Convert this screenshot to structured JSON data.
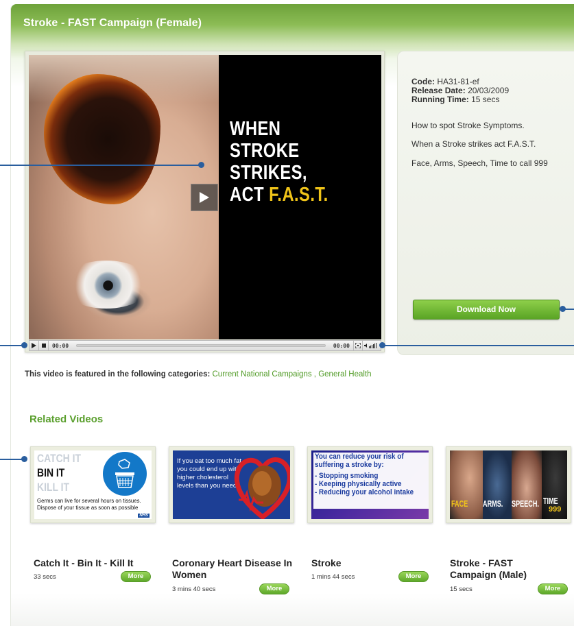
{
  "header": {
    "title": "Stroke - FAST Campaign (Female)"
  },
  "player": {
    "slogan": {
      "line1": "WHEN",
      "line2": "STROKE STRIKES,",
      "line3_prefix": "ACT ",
      "line3_highlight": "F.A.S.T."
    },
    "time_elapsed": "00:00",
    "time_total": "00:00"
  },
  "info": {
    "code_label": "Code:",
    "code_value": "HA31-81-ef",
    "release_label": "Release Date:",
    "release_value": "20/03/2009",
    "running_label": "Running Time:",
    "running_value": "15 secs",
    "desc1": "How to spot Stroke Symptoms.",
    "desc2": "When a Stroke strikes act F.A.S.T.",
    "desc3": "Face, Arms, Speech, Time to call 999",
    "download_label": "Download Now"
  },
  "categories": {
    "prefix": "This video is featured in the following categories:",
    "items": [
      "Current National Campaigns",
      "General Health"
    ],
    "separator": " , "
  },
  "related": {
    "title": "Related Videos",
    "more_label": "More",
    "videos": [
      {
        "title": "Catch It - Bin It - Kill It",
        "duration": "33 secs",
        "thumb": {
          "l1": "CATCH IT",
          "l2": "BIN IT",
          "l3": "KILL IT",
          "body": "Germs can live for several hours on tissues. Dispose of your tissue as soon as possible",
          "badge": "NHS"
        }
      },
      {
        "title": "Coronary Heart Disease In Women",
        "duration": "3 mins 40 secs",
        "thumb": {
          "body": "If you eat too much fat you could end up with higher cholesterol levels than you need"
        }
      },
      {
        "title": "Stroke",
        "duration": "1 mins 44 secs",
        "thumb": {
          "head": "You can reduce your risk of suffering a stroke by:",
          "b1": "- Stopping smoking",
          "b2": "- Keeping physically active",
          "b3": "- Reducing your alcohol intake"
        }
      },
      {
        "title": "Stroke - FAST Campaign (Male)",
        "duration": "15 secs",
        "thumb": {
          "w1": "FACE",
          "w2": "ARMS.",
          "w3": "SPEECH.",
          "w4": "TIME",
          "w5": "999"
        }
      }
    ]
  },
  "colors": {
    "accent_green": "#5a9f2d",
    "callout_blue": "#2a5e9e",
    "slogan_yellow": "#f0c419"
  }
}
